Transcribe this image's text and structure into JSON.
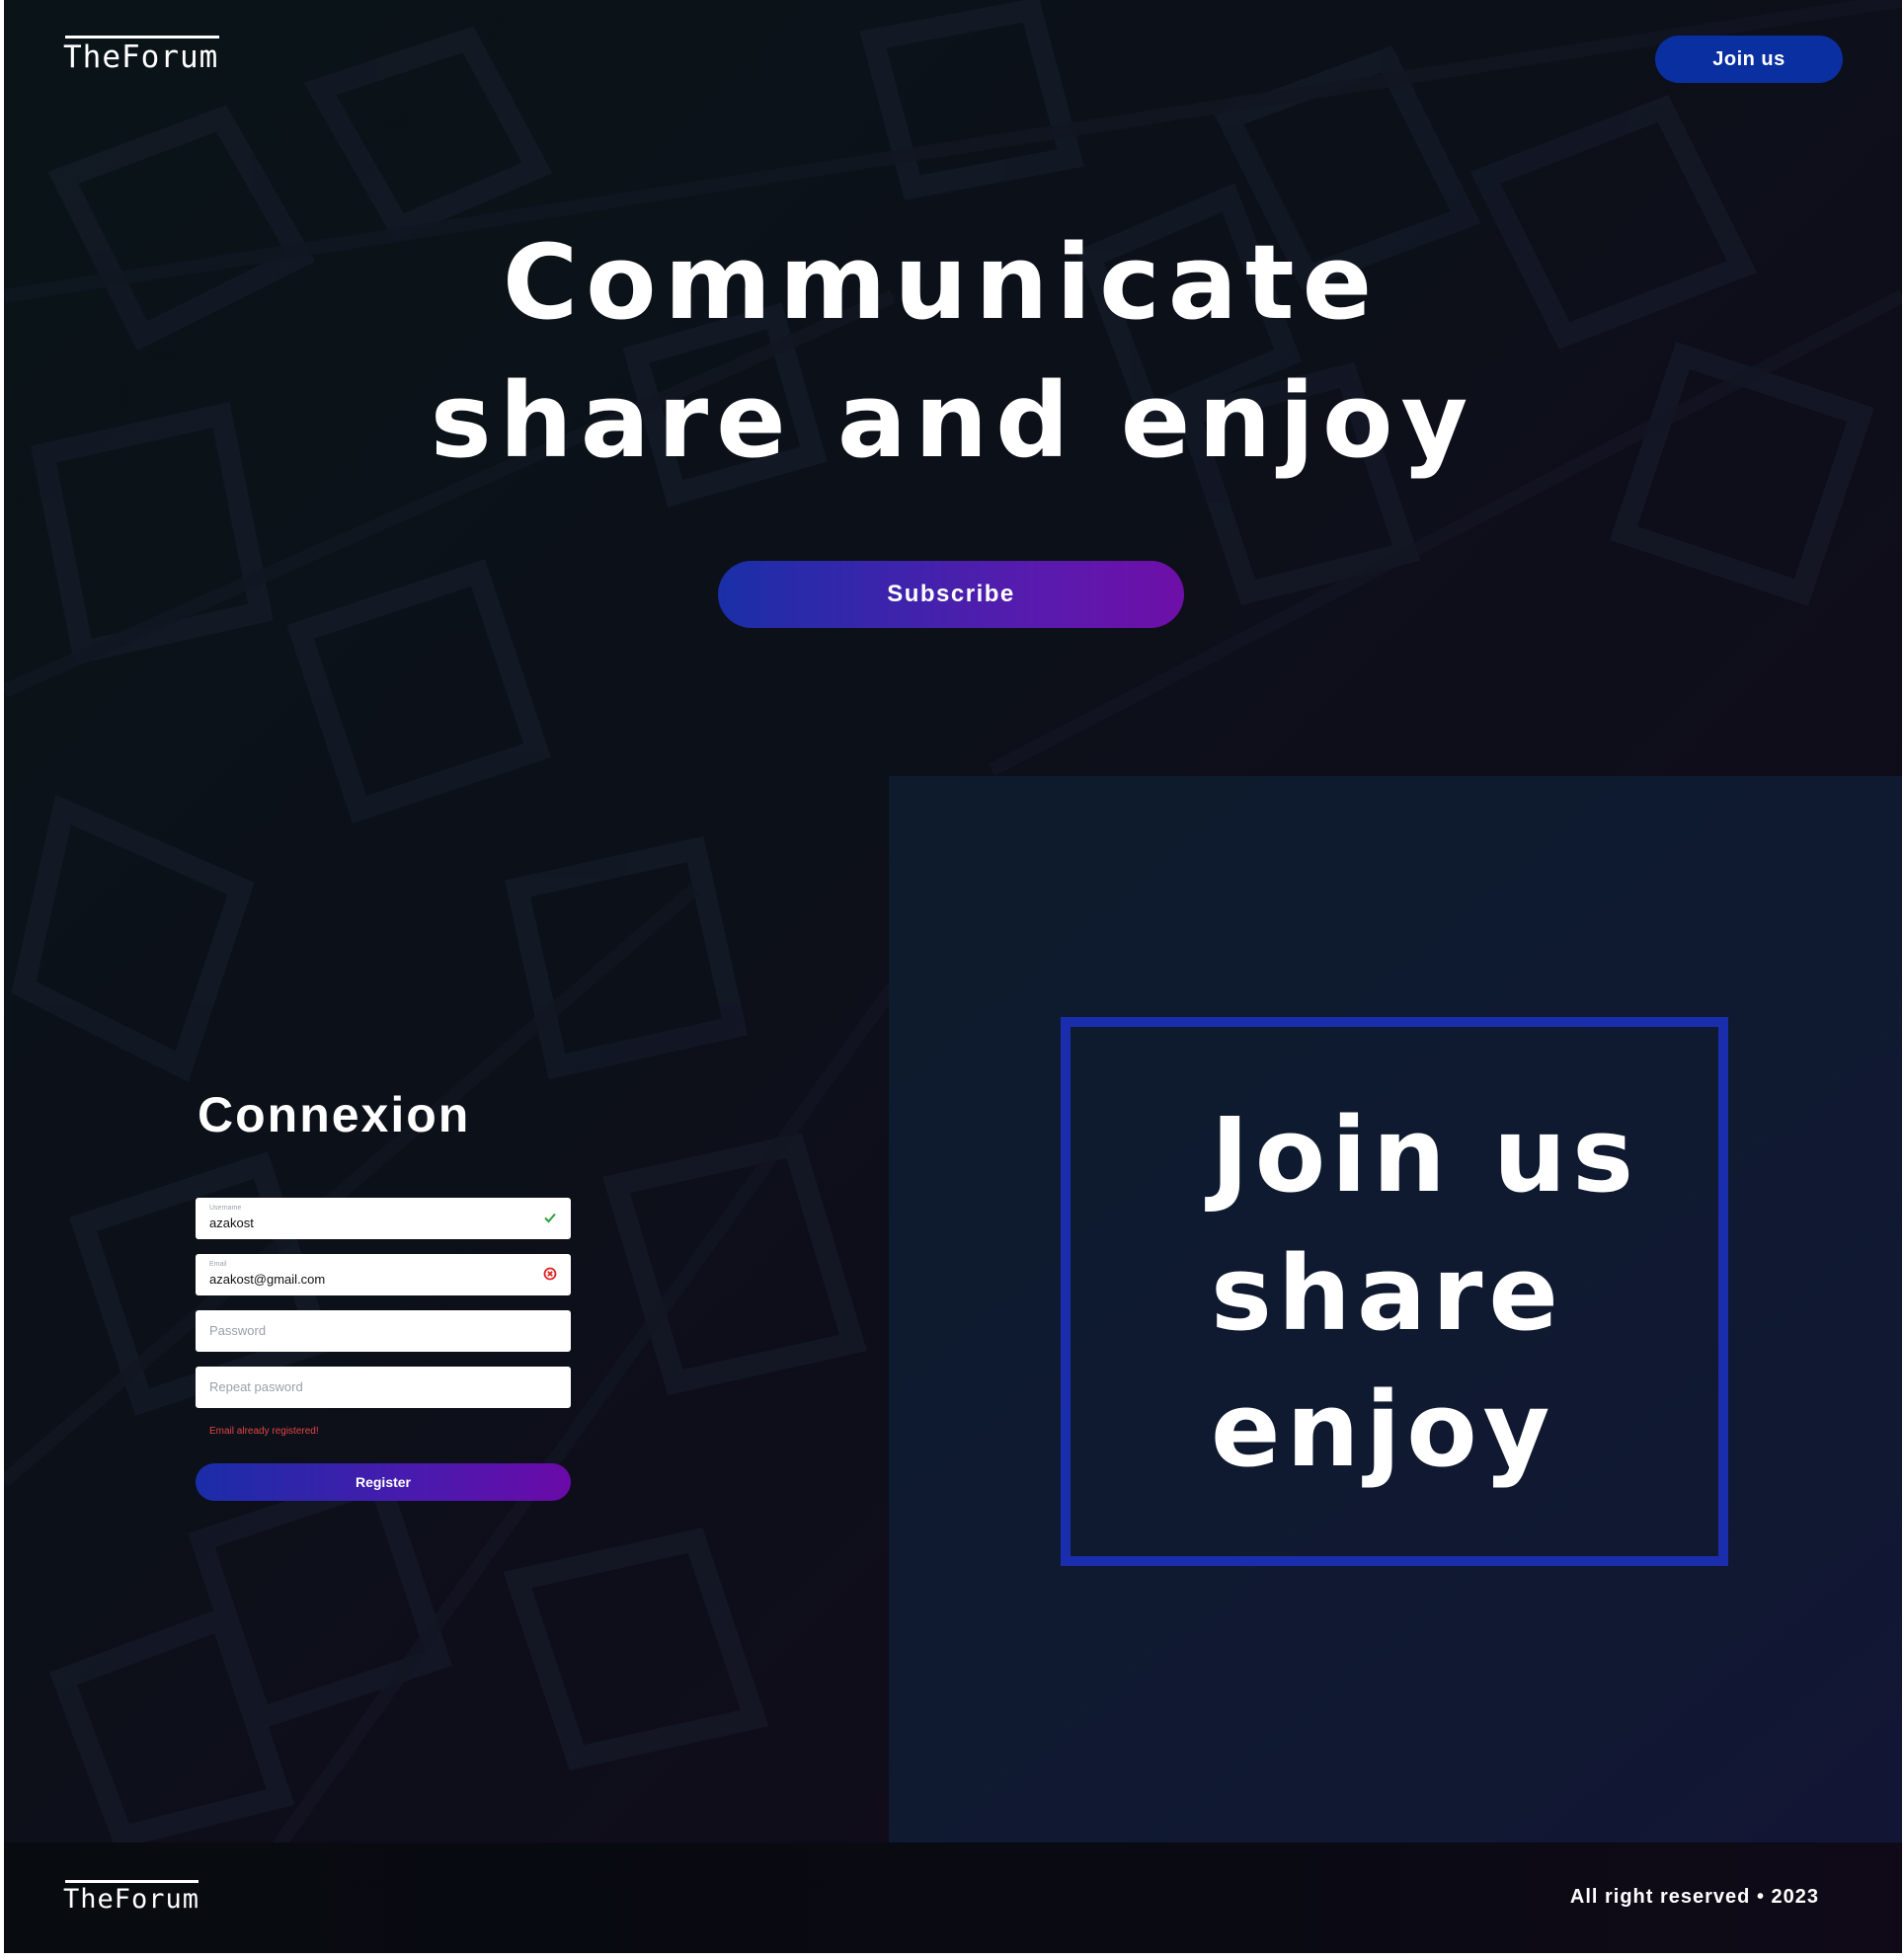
{
  "header": {
    "logo": "TheForum",
    "join_button": "Join us"
  },
  "hero": {
    "line1": "Communicate",
    "line2": "share and enjoy",
    "subscribe_button": "Subscribe"
  },
  "register_form": {
    "title": "Connexion",
    "fields": [
      {
        "label": "Username",
        "value": "azakost",
        "status": "valid",
        "status_color": "#2e9e3a"
      },
      {
        "label": "Email",
        "value": "azakost@gmail.com",
        "status": "error",
        "status_color": "#e02424"
      },
      {
        "placeholder": "Password"
      },
      {
        "placeholder": "Repeat pasword"
      }
    ],
    "error": "Email already registered!",
    "submit_button": "Register"
  },
  "join_panel": {
    "lines": [
      "Join us",
      "share",
      "enjoy"
    ],
    "border_color": "#1a2dad"
  },
  "footer": {
    "logo": "TheForum",
    "copyright": "All right reserved • 2023"
  },
  "colors": {
    "accent_blue": "#0a2fa0",
    "gradient_start": "#1a2fa8",
    "gradient_end": "#6e0fa8",
    "error": "#e24444"
  }
}
